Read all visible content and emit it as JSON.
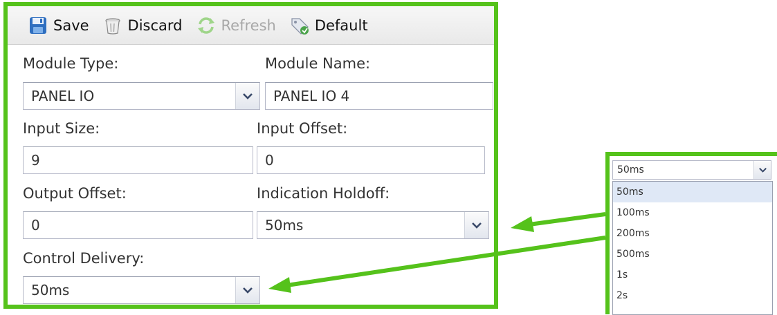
{
  "toolbar": {
    "save_label": "Save",
    "discard_label": "Discard",
    "refresh_label": "Refresh",
    "default_label": "Default"
  },
  "form": {
    "module_type_label": "Module Type:",
    "module_type_value": "PANEL IO",
    "module_name_label": "Module Name:",
    "module_name_value": "PANEL IO 4",
    "input_size_label": "Input Size:",
    "input_size_value": "9",
    "input_offset_label": "Input Offset:",
    "input_offset_value": "0",
    "output_offset_label": "Output Offset:",
    "output_offset_value": "0",
    "indication_holdoff_label": "Indication Holdoff:",
    "indication_holdoff_value": "50ms",
    "control_delivery_label": "Control Delivery:",
    "control_delivery_value": "50ms"
  },
  "dropdown": {
    "current_value": "50ms",
    "options": [
      "50ms",
      "100ms",
      "200ms",
      "500ms",
      "1s",
      "2s"
    ],
    "selected_index": 0
  },
  "colors": {
    "highlight_frame": "#55c21b",
    "selected_option_bg": "#dfe8f6"
  }
}
